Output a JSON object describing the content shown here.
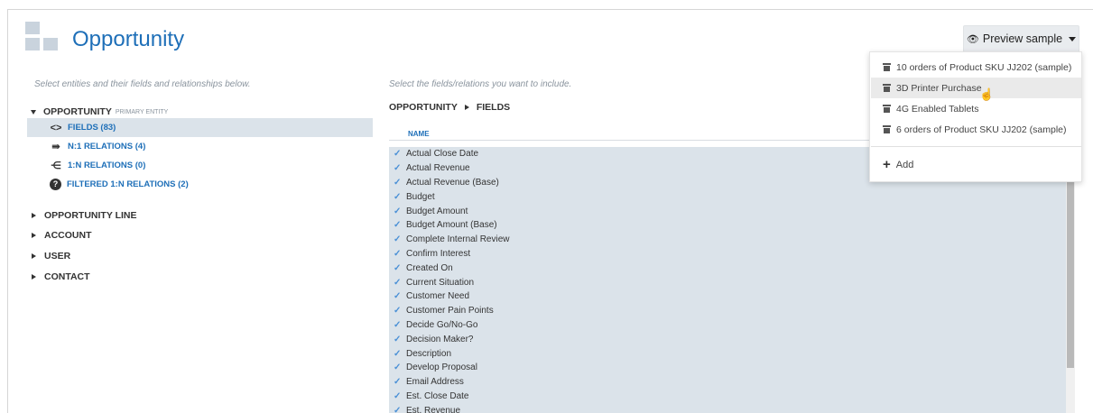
{
  "header": {
    "title": "Opportunity",
    "preview_button": "Preview sample"
  },
  "left_panel": {
    "hint": "Select entities and their fields and relationships below.",
    "root_entity": {
      "label": "OPPORTUNITY",
      "tag": "PRIMARY ENTITY",
      "children": [
        {
          "label": "FIELDS (83)",
          "icon": "code-icon"
        },
        {
          "label": "N:1 RELATIONS (4)",
          "icon": "arrow-right-relation-icon"
        },
        {
          "label": "1:N RELATIONS (0)",
          "icon": "arrow-left-relation-icon"
        },
        {
          "label": "FILTERED 1:N RELATIONS (2)",
          "icon": "question-circle-icon"
        }
      ]
    },
    "other_entities": [
      "OPPORTUNITY LINE",
      "ACCOUNT",
      "USER",
      "CONTACT"
    ]
  },
  "right_panel": {
    "hint": "Select the fields/relations you want to include.",
    "breadcrumb": [
      "OPPORTUNITY",
      "FIELDS"
    ],
    "column_header": "NAME",
    "fields": [
      "Actual Close Date",
      "Actual Revenue",
      "Actual Revenue (Base)",
      "Budget",
      "Budget Amount",
      "Budget Amount (Base)",
      "Complete Internal Review",
      "Confirm Interest",
      "Created On",
      "Current Situation",
      "Customer Need",
      "Customer Pain Points",
      "Decide Go/No-Go",
      "Decision Maker?",
      "Description",
      "Develop Proposal",
      "Email Address",
      "Est. Close Date",
      "Est. Revenue"
    ]
  },
  "dropdown": {
    "items": [
      "10 orders of Product SKU JJ202 (sample)",
      "3D Printer Purchase",
      "4G Enabled Tablets",
      "6 orders of Product SKU JJ202 (sample)"
    ],
    "add_label": "Add"
  },
  "colors": {
    "accent": "#1e6fb8",
    "selected_bg": "#dbe3ea",
    "check": "#4a90d6"
  }
}
